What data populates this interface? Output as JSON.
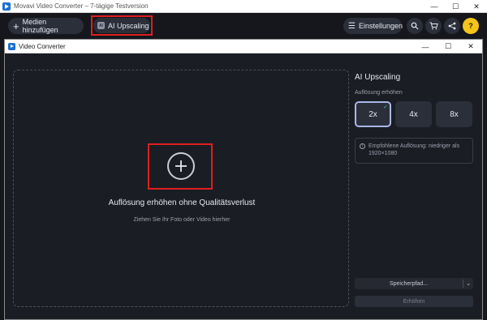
{
  "outer_window": {
    "title": "Movavi Video Converter – 7-tägige Testversion",
    "controls": {
      "minimize": "—",
      "maximize": "☐",
      "close": "✕"
    }
  },
  "toolbar": {
    "add_media_label": "Medien hinzufügen",
    "add_media_icon": "plus-icon",
    "ai_upscaling_label": "AI Upscaling",
    "ai_icon_text": "AI",
    "settings_label": "Einstellungen",
    "settings_icon": "menu-icon",
    "search_icon": "search-icon",
    "cart_icon": "cart-icon",
    "share_icon": "share-icon",
    "help_label": "?"
  },
  "dialog": {
    "title": "Video Converter",
    "controls": {
      "minimize": "—",
      "maximize": "☐",
      "close": "✕"
    }
  },
  "drop_zone": {
    "title": "Auflösung erhöhen ohne Qualitätsverlust",
    "hint": "Ziehen Sie Ihr Foto oder Video hierher",
    "add_icon": "plus-circle-icon"
  },
  "panel": {
    "title": "AI Upscaling",
    "subtitle": "Auflösung erhöhen",
    "scales": [
      {
        "label": "2x",
        "selected": true
      },
      {
        "label": "4x",
        "selected": false
      },
      {
        "label": "8x",
        "selected": false
      }
    ],
    "check_mark": "✓",
    "info_icon_text": "i",
    "info_text": "Empfohlene Auflösung: niedriger als 1920×1080",
    "save_path_label": "Speicherpfad...",
    "save_path_chevron": "⌄",
    "convert_label": "Erhöhen"
  },
  "colors": {
    "background": "#15171d",
    "dialog_bg": "#1b1d24",
    "highlight": "#e01e1e",
    "accent_selected": "#a9b7e8",
    "help_button": "#f5c518",
    "check": "#41c6a0"
  }
}
